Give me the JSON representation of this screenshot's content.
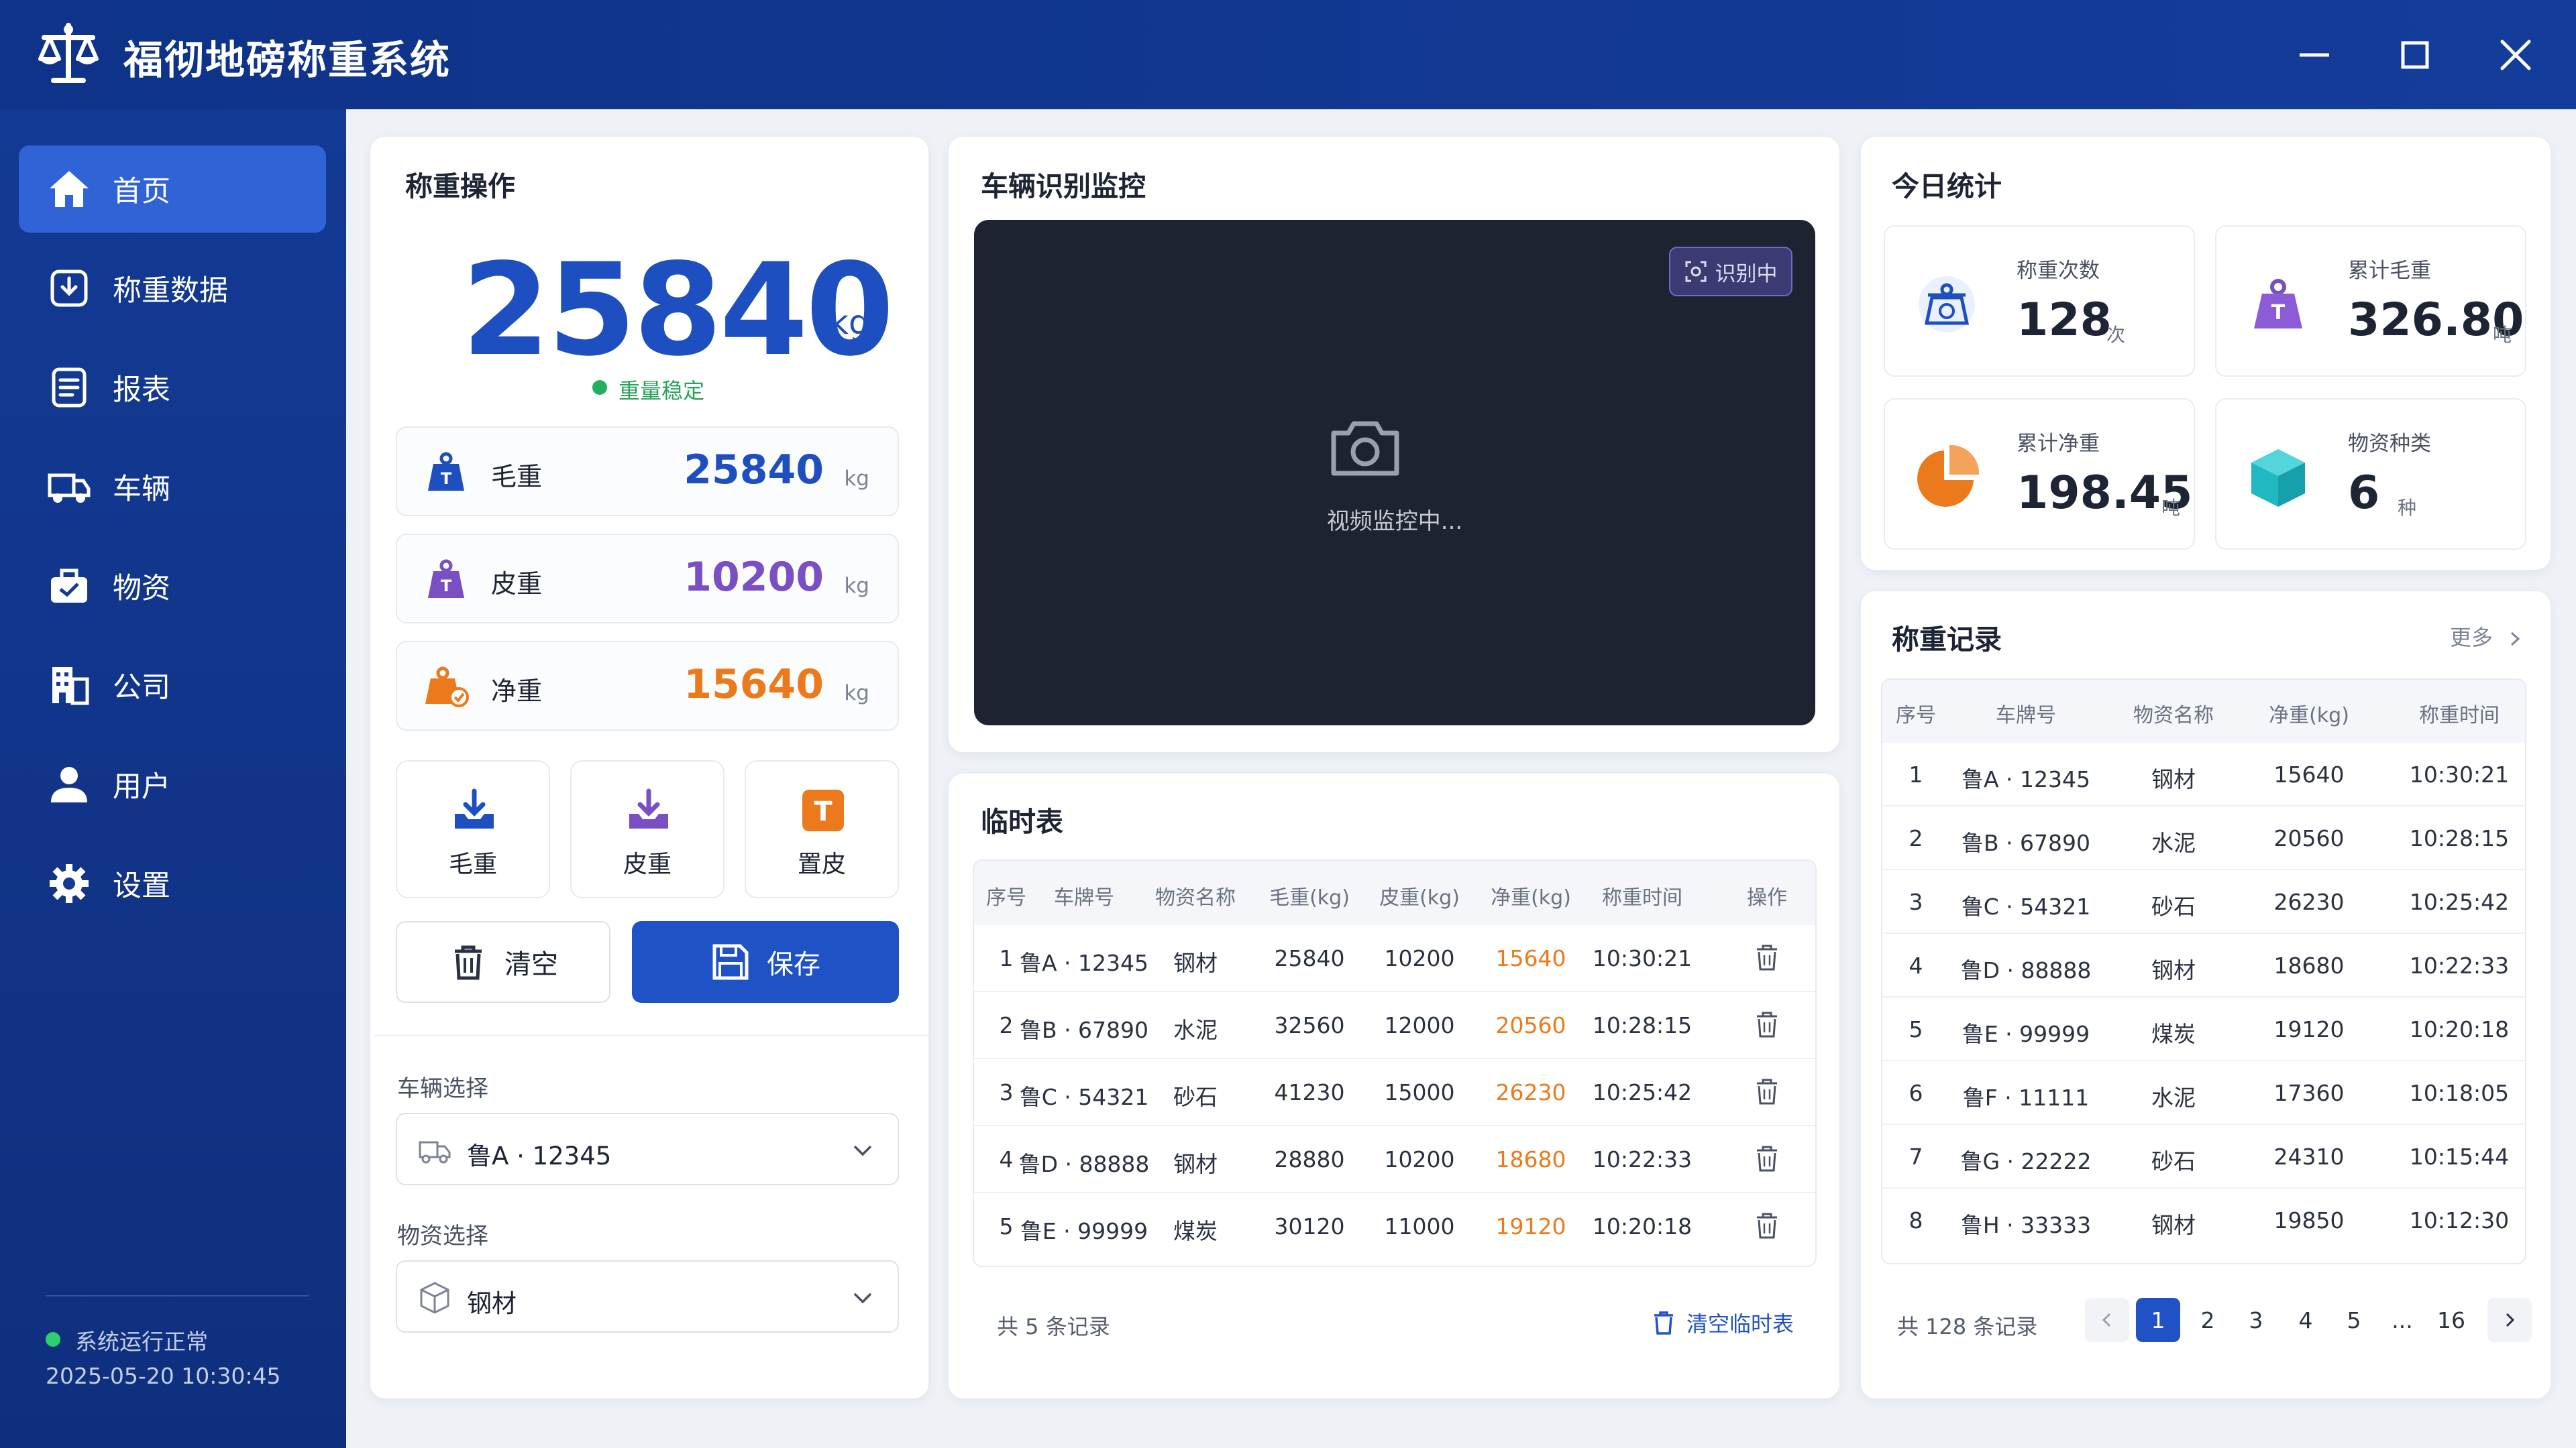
{
  "app": {
    "title": "福彻地磅称重系统"
  },
  "sidebar": {
    "items": [
      {
        "label": "首页",
        "icon": "home-icon",
        "active": true
      },
      {
        "label": "称重数据",
        "icon": "weigh-data-icon"
      },
      {
        "label": "报表",
        "icon": "report-icon"
      },
      {
        "label": "车辆",
        "icon": "truck-icon"
      },
      {
        "label": "物资",
        "icon": "materials-icon"
      },
      {
        "label": "公司",
        "icon": "company-icon"
      },
      {
        "label": "用户",
        "icon": "user-icon"
      },
      {
        "label": "设置",
        "icon": "gear-icon"
      }
    ],
    "status": "系统运行正常",
    "datetime": "2025-05-20  10:30:45"
  },
  "weigh": {
    "title": "称重操作",
    "current_value": "25840",
    "unit": "kg",
    "status": "重量稳定",
    "rows": [
      {
        "label": "毛重",
        "value": "25840",
        "unit": "kg",
        "color": "#1e4fc0"
      },
      {
        "label": "皮重",
        "value": "10200",
        "unit": "kg",
        "color": "#7a4fc4"
      },
      {
        "label": "净重",
        "value": "15640",
        "unit": "kg",
        "color": "#ea7a1c"
      }
    ],
    "actions": [
      "毛重",
      "皮重",
      "置皮"
    ],
    "clear_label": "清空",
    "save_label": "保存",
    "vehicle_label": "车辆选择",
    "vehicle_value": "鲁A · 12345",
    "material_label": "物资选择",
    "material_value": "钢材"
  },
  "monitor": {
    "title": "车辆识别监控",
    "badge": "识别中",
    "video_text": "视频监控中..."
  },
  "temp": {
    "title": "临时表",
    "headers": [
      "序号",
      "车牌号",
      "物资名称",
      "毛重(kg)",
      "皮重(kg)",
      "净重(kg)",
      "称重时间",
      "操作"
    ],
    "rows": [
      [
        "1",
        "鲁A · 12345",
        "钢材",
        "25840",
        "10200",
        "15640",
        "10:30:21"
      ],
      [
        "2",
        "鲁B · 67890",
        "水泥",
        "32560",
        "12000",
        "20560",
        "10:28:15"
      ],
      [
        "3",
        "鲁C · 54321",
        "砂石",
        "41230",
        "15000",
        "26230",
        "10:25:42"
      ],
      [
        "4",
        "鲁D · 88888",
        "钢材",
        "28880",
        "10200",
        "18680",
        "10:22:33"
      ],
      [
        "5",
        "鲁E · 99999",
        "煤炭",
        "30120",
        "11000",
        "19120",
        "10:20:18"
      ]
    ],
    "footer": "共 5 条记录",
    "clear_label": "清空临时表"
  },
  "stats": {
    "title": "今日统计",
    "items": [
      {
        "label": "称重次数",
        "value": "128",
        "unit": "次",
        "icon": "scale-icon"
      },
      {
        "label": "累计毛重",
        "value": "326.80",
        "unit": "吨",
        "icon": "weight-icon"
      },
      {
        "label": "累计净重",
        "value": "198.45",
        "unit": "吨",
        "icon": "pie-chart-icon"
      },
      {
        "label": "物资种类",
        "value": "6",
        "unit": "种",
        "icon": "cube-icon"
      }
    ]
  },
  "records": {
    "title": "称重记录",
    "more": "更多",
    "headers": [
      "序号",
      "车牌号",
      "物资名称",
      "净重(kg)",
      "称重时间"
    ],
    "rows": [
      [
        "1",
        "鲁A · 12345",
        "钢材",
        "15640",
        "10:30:21"
      ],
      [
        "2",
        "鲁B · 67890",
        "水泥",
        "20560",
        "10:28:15"
      ],
      [
        "3",
        "鲁C · 54321",
        "砂石",
        "26230",
        "10:25:42"
      ],
      [
        "4",
        "鲁D · 88888",
        "钢材",
        "18680",
        "10:22:33"
      ],
      [
        "5",
        "鲁E · 99999",
        "煤炭",
        "19120",
        "10:20:18"
      ],
      [
        "6",
        "鲁F · 11111",
        "水泥",
        "17360",
        "10:18:05"
      ],
      [
        "7",
        "鲁G · 22222",
        "砂石",
        "24310",
        "10:15:44"
      ],
      [
        "8",
        "鲁H · 33333",
        "钢材",
        "19850",
        "10:12:30"
      ]
    ],
    "footer": "共 128 条记录",
    "pages": [
      "1",
      "2",
      "3",
      "4",
      "5",
      "...",
      "16"
    ],
    "current_page": "1"
  },
  "colors": {
    "primary": "#1f52c5",
    "orange": "#ea7a1c",
    "purple": "#7a4fc4",
    "green": "#22b05e",
    "sidebar": "#133a94"
  }
}
